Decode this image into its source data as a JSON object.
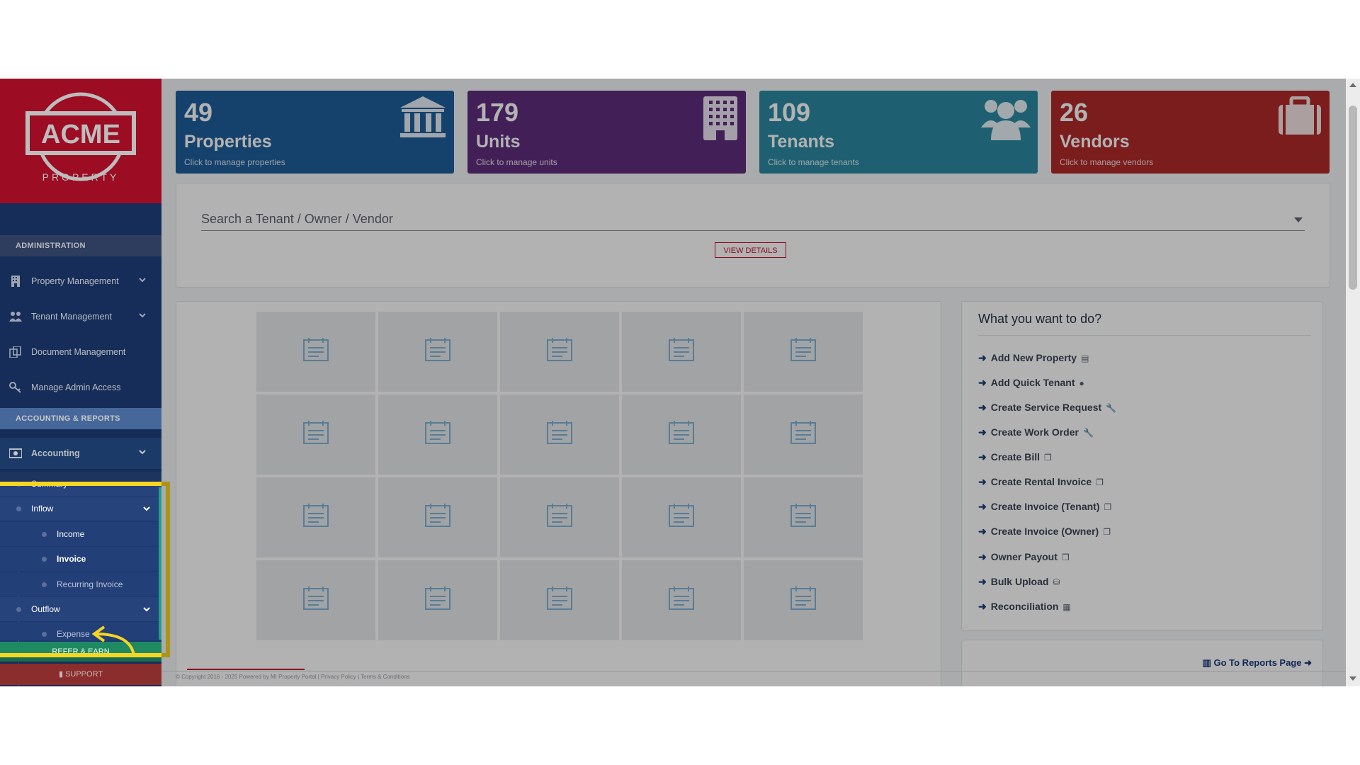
{
  "brand": {
    "logo_text": "ACME",
    "logo_sub": "PROPERTY"
  },
  "sidebar": {
    "admin_heading": "ADMINISTRATION",
    "admin_items": [
      {
        "label": "Property Management",
        "icon": "building-icon",
        "has_chevron": true
      },
      {
        "label": "Tenant Management",
        "icon": "users-icon",
        "has_chevron": true
      },
      {
        "label": "Document Management",
        "icon": "documents-icon",
        "has_chevron": false
      },
      {
        "label": "Manage Admin Access",
        "icon": "key-icon",
        "has_chevron": false
      }
    ],
    "acct_heading": "ACCOUNTING & REPORTS",
    "accounting": {
      "label": "Accounting",
      "icon": "money-icon"
    },
    "summary": "Summary",
    "inflow": "Inflow",
    "income": "Income",
    "invoice": "Invoice",
    "recurring_invoice": "Recurring Invoice",
    "outflow": "Outflow",
    "expense": "Expense",
    "refer": "REFER & EARN",
    "support": "SUPPORT"
  },
  "cards": [
    {
      "count": "49",
      "label": "Properties",
      "sub": "Click to manage properties",
      "color": "#1f5f9b",
      "icon": "bank-icon"
    },
    {
      "count": "179",
      "label": "Units",
      "sub": "Click to manage units",
      "color": "#5f2f7d",
      "icon": "building-grid-icon"
    },
    {
      "count": "109",
      "label": "Tenants",
      "sub": "Click to manage tenants",
      "color": "#2c8aa2",
      "icon": "users-icon"
    },
    {
      "count": "26",
      "label": "Vendors",
      "sub": "Click to manage vendors",
      "color": "#b12a2a",
      "icon": "briefcase-icon"
    }
  ],
  "search": {
    "placeholder": "Search a Tenant / Owner / Vendor",
    "button": "VIEW DETAILS"
  },
  "todo": {
    "title": "What you want to do?",
    "items": [
      {
        "label": "Add New Property",
        "icon": "building-icon"
      },
      {
        "label": "Add Quick Tenant",
        "icon": "user-icon"
      },
      {
        "label": "Create Service Request",
        "icon": "wrench-icon"
      },
      {
        "label": "Create Work Order",
        "icon": "wrench-icon"
      },
      {
        "label": "Create Bill",
        "icon": "copy-icon"
      },
      {
        "label": "Create Rental Invoice",
        "icon": "copy-icon"
      },
      {
        "label": "Create Invoice (Tenant)",
        "icon": "copy-icon"
      },
      {
        "label": "Create Invoice (Owner)",
        "icon": "copy-icon"
      },
      {
        "label": "Owner Payout",
        "icon": "copy-icon"
      },
      {
        "label": "Bulk Upload",
        "icon": "database-icon"
      },
      {
        "label": "Reconciliation",
        "icon": "calculator-icon"
      }
    ],
    "reports_link": "Go To Reports Page"
  },
  "footer": "© Copyright 2016 - 2025 Powered by MI Property Portal | Privacy Policy | Terms & Conditions"
}
